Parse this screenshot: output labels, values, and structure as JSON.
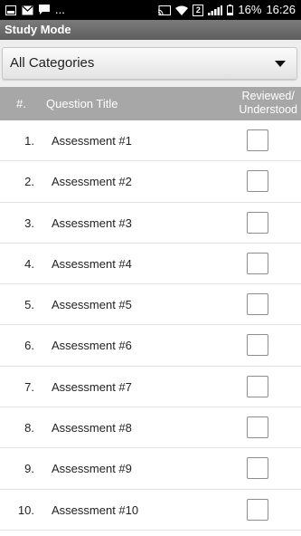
{
  "status_bar": {
    "left_icons": [
      "notification-icon",
      "mail-icon",
      "chat-icon"
    ],
    "overflow": "...",
    "right_icons": [
      "cast-icon",
      "wifi-icon",
      "sim-2-icon",
      "signal-icon",
      "battery-icon"
    ],
    "sim_badge": "2",
    "battery": "16%",
    "time": "16:26"
  },
  "app_bar": {
    "title": "Study Mode"
  },
  "category_select": {
    "selected": "All Categories"
  },
  "table": {
    "headers": {
      "num": "#.",
      "title": "Question Title",
      "reviewed_line1": "Reviewed/",
      "reviewed_line2": "Understood"
    },
    "rows": [
      {
        "num": "1.",
        "title": "Assessment #1",
        "checked": false
      },
      {
        "num": "2.",
        "title": "Assessment #2",
        "checked": false
      },
      {
        "num": "3.",
        "title": "Assessment #3",
        "checked": false
      },
      {
        "num": "4.",
        "title": "Assessment #4",
        "checked": false
      },
      {
        "num": "5.",
        "title": "Assessment #5",
        "checked": false
      },
      {
        "num": "6.",
        "title": "Assessment #6",
        "checked": false
      },
      {
        "num": "7.",
        "title": "Assessment #7",
        "checked": false
      },
      {
        "num": "8.",
        "title": "Assessment #8",
        "checked": false
      },
      {
        "num": "9.",
        "title": "Assessment #9",
        "checked": false
      },
      {
        "num": "10.",
        "title": "Assessment #10",
        "checked": false
      }
    ]
  }
}
